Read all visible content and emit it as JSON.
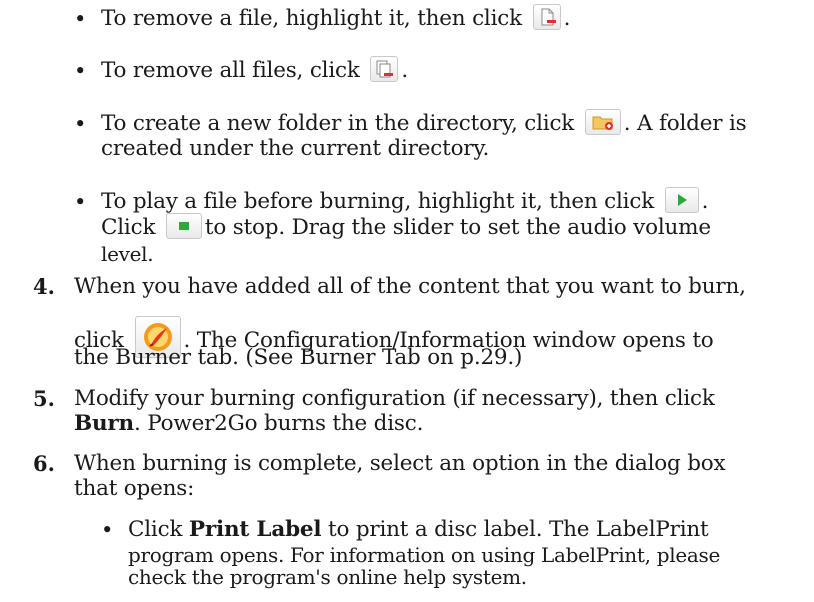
{
  "bullets_top": [
    {
      "pre": "To remove a file, highlight it, then click",
      "post": "."
    },
    {
      "pre": "To remove all files, click",
      "post": "."
    },
    {
      "pre": "To create a new folder in the directory, click",
      "post": ". A folder is",
      "line2": "created under the current directory."
    },
    {
      "pre": "To play a file before burning, highlight it, then click",
      "post": ".",
      "line2_pre": "Click",
      "line2_post": "to stop. Drag the slider to set the audio volume",
      "line3": "level."
    }
  ],
  "steps": [
    {
      "num": "4.",
      "l1": "When you have added all of the content that you want to burn,",
      "l2_pre": "click",
      "l2_post": ". The Configuration/Information window opens to",
      "l3": "the Burner tab. (See Burner Tab on p.29.)"
    },
    {
      "num": "5.",
      "l1": "Modify your burning configuration (if necessary), then click",
      "l2_bold": "Burn",
      "l2_post": ". Power2Go burns the disc."
    },
    {
      "num": "6.",
      "l1": "When burning is complete, select an option in the dialog box",
      "l2": "that opens:"
    }
  ],
  "sub_bullet": {
    "pre": "Click",
    "bold": "Print Label",
    "post": "to print a disc label. The LabelPrint",
    "line2": "program opens. For information on using LabelPrint, please",
    "line3": "check the program's online help system."
  },
  "icons": [
    "remove-file-icon",
    "remove-all-files-icon",
    "new-folder-icon",
    "play-icon",
    "stop-icon",
    "burn-icon"
  ]
}
